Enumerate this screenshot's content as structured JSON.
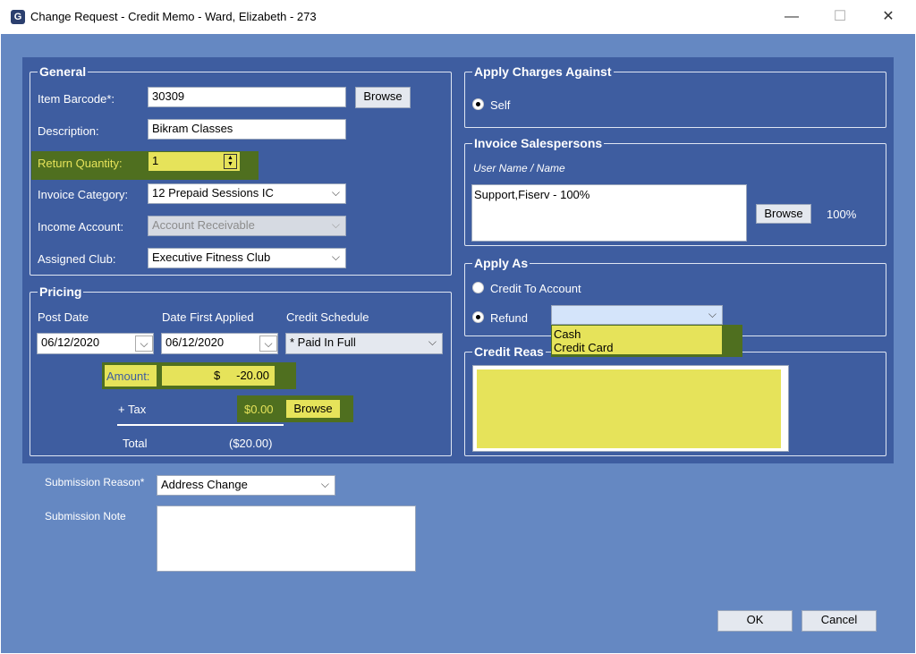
{
  "window": {
    "title": "Change Request - Credit Memo - Ward, Elizabeth - 273",
    "minimize_glyph": "—",
    "maximize_glyph": "☐",
    "close_glyph": "✕",
    "app_icon_letter": "G"
  },
  "general": {
    "legend": "General",
    "item_barcode_label": "Item Barcode*:",
    "item_barcode_value": "30309",
    "browse_label": "Browse",
    "description_label": "Description:",
    "description_value": "Bikram Classes",
    "return_quantity_label": "Return Quantity:",
    "return_quantity_value": "1",
    "invoice_category_label": "Invoice Category:",
    "invoice_category_value": "12 Prepaid Sessions IC",
    "income_account_label": "Income Account:",
    "income_account_value": "Account Receivable",
    "assigned_club_label": "Assigned Club:",
    "assigned_club_value": "Executive Fitness Club"
  },
  "pricing": {
    "legend": "Pricing",
    "post_date_label": "Post Date",
    "post_date_value": "06/12/2020",
    "date_first_applied_label": "Date First Applied",
    "date_first_applied_value": "06/12/2020",
    "credit_schedule_label": "Credit Schedule",
    "credit_schedule_value": "* Paid In Full",
    "amount_label": "Amount:",
    "amount_currency": "$",
    "amount_value": "-20.00",
    "tax_label": "+ Tax",
    "tax_value": "$0.00",
    "tax_browse_label": "Browse",
    "total_label": "Total",
    "total_value": "($20.00)"
  },
  "apply_charges": {
    "legend": "Apply Charges Against",
    "self_label": "Self"
  },
  "salespersons": {
    "legend": "Invoice Salespersons",
    "column_header": "User Name / Name",
    "entries": [
      "Support,Fiserv - 100%"
    ],
    "browse_label": "Browse",
    "percent": "100%"
  },
  "apply_as": {
    "legend": "Apply As",
    "credit_to_account_label": "Credit To Account",
    "refund_label": "Refund",
    "refund_options": [
      "Cash",
      "Credit Card"
    ]
  },
  "credit_reason": {
    "legend": "Credit Reas"
  },
  "submission": {
    "reason_label": "Submission Reason*",
    "reason_value": "Address Change",
    "note_label": "Submission Note"
  },
  "footer": {
    "ok_label": "OK",
    "cancel_label": "Cancel"
  },
  "colors": {
    "client_bg": "#6588c2",
    "panel_bg": "#3e5da0",
    "highlight": "#e6e35a",
    "highlight_border": "#4f6f1f"
  }
}
